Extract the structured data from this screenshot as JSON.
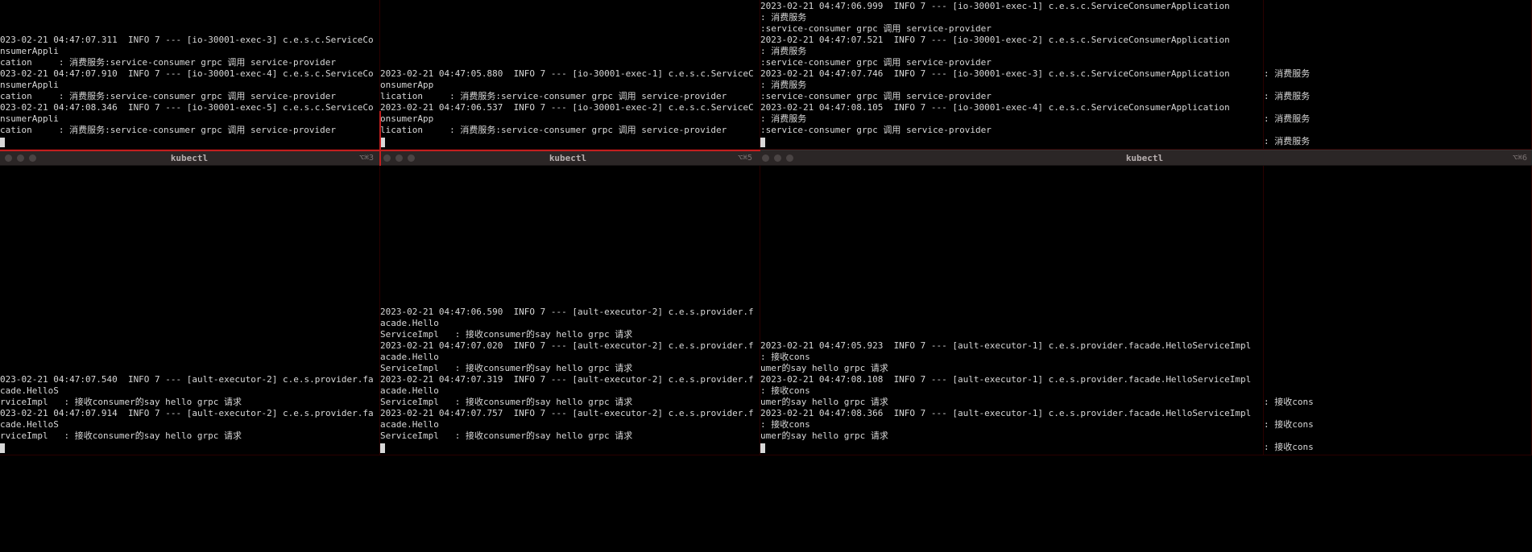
{
  "top": {
    "p1": {
      "lines": "023-02-21 04:47:07.311  INFO 7 --- [io-30001-exec-3] c.e.s.c.ServiceConsumerAppli\ncation     : 消费服务:service-consumer grpc 调用 service-provider\n023-02-21 04:47:07.910  INFO 7 --- [io-30001-exec-4] c.e.s.c.ServiceConsumerAppli\ncation     : 消费服务:service-consumer grpc 调用 service-provider\n023-02-21 04:47:08.346  INFO 7 --- [io-30001-exec-5] c.e.s.c.ServiceConsumerAppli\ncation     : 消费服务:service-consumer grpc 调用 service-provider"
    },
    "p2": {
      "lines": "2023-02-21 04:47:05.880  INFO 7 --- [io-30001-exec-1] c.e.s.c.ServiceConsumerApp\nlication     : 消费服务:service-consumer grpc 调用 service-provider\n2023-02-21 04:47:06.537  INFO 7 --- [io-30001-exec-2] c.e.s.c.ServiceConsumerApp\nlication     : 消费服务:service-consumer grpc 调用 service-provider"
    },
    "p3": {
      "lines": "2023-02-21 04:47:06.999  INFO 7 --- [io-30001-exec-1] c.e.s.c.ServiceConsumerApplication        : 消费服务\n:service-consumer grpc 调用 service-provider\n2023-02-21 04:47:07.521  INFO 7 --- [io-30001-exec-2] c.e.s.c.ServiceConsumerApplication        : 消费服务\n:service-consumer grpc 调用 service-provider\n2023-02-21 04:47:07.746  INFO 7 --- [io-30001-exec-3] c.e.s.c.ServiceConsumerApplication        : 消费服务\n:service-consumer grpc 调用 service-provider\n2023-02-21 04:47:08.105  INFO 7 --- [io-30001-exec-4] c.e.s.c.ServiceConsumerApplication        : 消费服务\n:service-consumer grpc 调用 service-provider"
    },
    "p4": {
      "lines": ": 消费服务\n\n: 消费服务\n\n: 消费服务\n\n: 消费服务"
    }
  },
  "tabs": {
    "t1": {
      "title": "kubectl",
      "shortcut": "⌥⌘3"
    },
    "t2": {
      "title": "kubectl",
      "shortcut": "⌥⌘5"
    },
    "t3": {
      "title": "kubectl",
      "shortcut": "⌥⌘6"
    }
  },
  "bot": {
    "p1": {
      "lines": "023-02-21 04:47:07.540  INFO 7 --- [ault-executor-2] c.e.s.provider.facade.HelloS\nrviceImpl   : 接收consumer的say hello grpc 请求\n023-02-21 04:47:07.914  INFO 7 --- [ault-executor-2] c.e.s.provider.facade.HelloS\nrviceImpl   : 接收consumer的say hello grpc 请求"
    },
    "p2": {
      "lines": "2023-02-21 04:47:06.590  INFO 7 --- [ault-executor-2] c.e.s.provider.facade.Hello\nServiceImpl   : 接收consumer的say hello grpc 请求\n2023-02-21 04:47:07.020  INFO 7 --- [ault-executor-2] c.e.s.provider.facade.Hello\nServiceImpl   : 接收consumer的say hello grpc 请求\n2023-02-21 04:47:07.319  INFO 7 --- [ault-executor-2] c.e.s.provider.facade.Hello\nServiceImpl   : 接收consumer的say hello grpc 请求\n2023-02-21 04:47:07.757  INFO 7 --- [ault-executor-2] c.e.s.provider.facade.Hello\nServiceImpl   : 接收consumer的say hello grpc 请求"
    },
    "p3": {
      "lines": "2023-02-21 04:47:05.923  INFO 7 --- [ault-executor-1] c.e.s.provider.facade.HelloServiceImpl   : 接收cons\numer的say hello grpc 请求\n2023-02-21 04:47:08.108  INFO 7 --- [ault-executor-1] c.e.s.provider.facade.HelloServiceImpl   : 接收cons\numer的say hello grpc 请求\n2023-02-21 04:47:08.366  INFO 7 --- [ault-executor-1] c.e.s.provider.facade.HelloServiceImpl   : 接收cons\numer的say hello grpc 请求"
    },
    "p4": {
      "lines": ": 接收cons\n\n: 接收cons\n\n: 接收cons"
    }
  }
}
